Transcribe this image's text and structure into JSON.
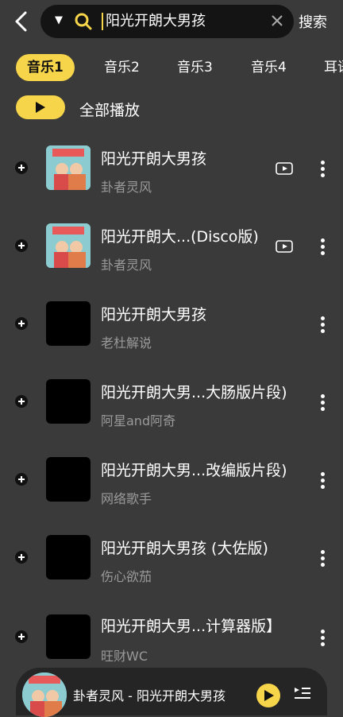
{
  "search": {
    "query": "阳光开朗大男孩",
    "button_label": "搜索"
  },
  "tabs": [
    {
      "label": "音乐1",
      "active": true
    },
    {
      "label": "音乐2",
      "active": false
    },
    {
      "label": "音乐3",
      "active": false
    },
    {
      "label": "音乐4",
      "active": false
    },
    {
      "label": "耳语",
      "active": false
    }
  ],
  "play_all": {
    "label": "全部播放"
  },
  "songs": [
    {
      "title": "阳光开朗大男孩",
      "artist": "卦者灵风",
      "has_art": true,
      "has_mv": true
    },
    {
      "title": "阳光开朗大...(Disco版)",
      "artist": "卦者灵风",
      "has_art": true,
      "has_mv": true
    },
    {
      "title": "阳光开朗大男孩",
      "artist": "老杜解说",
      "has_art": false,
      "has_mv": false
    },
    {
      "title": "阳光开朗大男...大肠版片段)",
      "artist": "阿星and阿奇",
      "has_art": false,
      "has_mv": false
    },
    {
      "title": "阳光开朗大男...改编版片段)",
      "artist": "网络歌手",
      "has_art": false,
      "has_mv": false
    },
    {
      "title": "阳光开朗大男孩 (大佐版)",
      "artist": "伤心欲茄",
      "has_art": false,
      "has_mv": false
    },
    {
      "title": "阳光开朗大男...计算器版】",
      "artist": "旺财WC",
      "has_art": false,
      "has_mv": false
    }
  ],
  "player": {
    "now_playing": "卦者灵风 - 阳光开朗大男孩"
  },
  "colors": {
    "accent": "#f7d54a",
    "background": "#3a3a3a"
  }
}
